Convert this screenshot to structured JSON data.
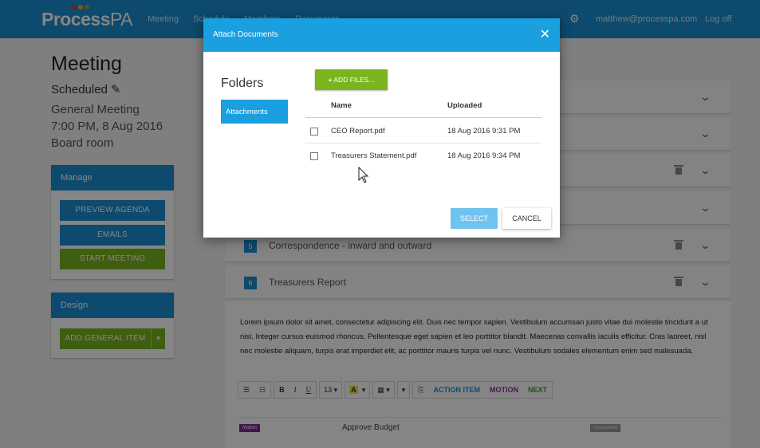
{
  "app": {
    "logo_main": "Process",
    "logo_suffix": "PA",
    "logo_dot_colors": [
      "#e53935",
      "#f5a623",
      "#7ab51d"
    ],
    "nav": [
      "Meeting",
      "Schedule",
      "Members",
      "Documents"
    ],
    "gear_icon": "gear-icon",
    "user_email": "matthew@processpa.com",
    "logoff_label": "Log off",
    "accent_color": "#1a8fd1",
    "green_color": "#7ab51d"
  },
  "meeting": {
    "title": "Meeting",
    "status": "Scheduled",
    "edit_icon": "pencil-icon",
    "type": "General Meeting",
    "datetime": "7:00 PM, 8 Aug 2016",
    "location": "Board room"
  },
  "manage_panel": {
    "title": "Manage",
    "preview_agenda": "PREVIEW AGENDA",
    "emails": "EMAILS",
    "start_meeting": "START MEETING"
  },
  "design_panel": {
    "title": "Design",
    "add_general_item": "ADD GENERAL ITEM"
  },
  "agenda": {
    "items": [
      {
        "number": "5",
        "label": "Correspondence - inward and outward"
      },
      {
        "number": "6",
        "label": "Treasurers Report"
      }
    ],
    "expanded_text": "Lorem ipsum dolor sit amet, consectetur adipiscing elit. Duis nec tempor sapien. Vestibulum accumsan justo vitae dui molestie tincidunt a ut nisi. Integer cursus euismod rhoncus. Pellentesque eget sapien et leo porttitor blandit. Maecenas convallis iaculis efficitur. Cras laoreet, nisl nec molestie aliquam, turpis erat imperdiet elit, ac porttitor mauris turpis vel nunc. Vestibulum sodales elementum enim sed malesuada.",
    "toolbar": {
      "font_size": "13",
      "action_item": "ACTION ITEM",
      "motion": "MOTION",
      "next": "NEXT"
    },
    "sub_item": {
      "badge": "Motion",
      "title": "Approve Budget",
      "status": "Unresolved"
    }
  },
  "modal": {
    "title": "Attach Documents",
    "folders_heading": "Folders",
    "folder_selected": "Attachments",
    "add_files": "ADD FILES...",
    "columns": {
      "name": "Name",
      "uploaded": "Uploaded"
    },
    "files": [
      {
        "name": "CEO Report.pdf",
        "uploaded": "18 Aug 2016 9:31 PM"
      },
      {
        "name": "Treasurers Statement.pdf",
        "uploaded": "18 Aug 2016 9:34 PM"
      }
    ],
    "select_label": "SELECT",
    "cancel_label": "CANCEL"
  }
}
